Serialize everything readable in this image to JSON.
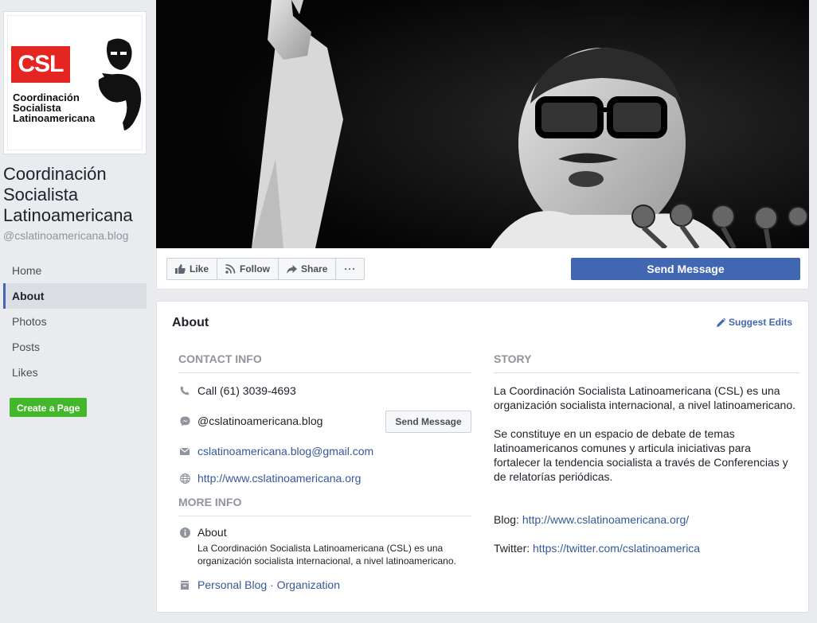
{
  "profile": {
    "logo_abbr": "CSL",
    "logo_line1": "Coordinación",
    "logo_line2": "Socialista",
    "logo_line3": "Latinoamericana",
    "page_name": "Coordinación Socialista Latinoamericana",
    "handle": "@cslatinoamericana.blog"
  },
  "nav": {
    "items": [
      {
        "label": "Home"
      },
      {
        "label": "About"
      },
      {
        "label": "Photos"
      },
      {
        "label": "Posts"
      },
      {
        "label": "Likes"
      }
    ],
    "active": "About"
  },
  "create_page": "Create a Page",
  "actions": {
    "like": "Like",
    "follow": "Follow",
    "share": "Share",
    "more": "···",
    "send_message": "Send Message"
  },
  "about": {
    "title": "About",
    "suggest_edits": "Suggest Edits",
    "contact_heading": "CONTACT INFO",
    "phone": "Call (61) 3039-4693",
    "messenger": "@cslatinoamericana.blog",
    "send_message": "Send Message",
    "email": "cslatinoamericana.blog@gmail.com",
    "website": "http://www.cslatinoamericana.org",
    "more_heading": "MORE INFO",
    "about_label": "About",
    "about_desc": "La Coordinación Socialista Latinoamericana (CSL) es una organización socialista internacional, a nivel latinoamericano.",
    "category_1": "Personal Blog",
    "category_sep": " · ",
    "category_2": "Organization",
    "story_heading": "STORY",
    "story_p1": "La Coordinación Socialista Latinoamericana (CSL) es una organización socialista internacional, a nivel latinoamericano.",
    "story_p2": "Se constituye en un espacio de debate de temas latinoamericanos comunes y articula iniciativas para fortalecer la tendencia socialista a través de Conferencias y de relatorías periódicas.",
    "blog_label": "Blog: ",
    "blog_url": "http://www.cslatinoamericana.org/",
    "twitter_label": "Twitter: ",
    "twitter_url": "https://twitter.com/cslatinoamerica"
  },
  "colors": {
    "brand_blue": "#4267b2",
    "link": "#365899",
    "green": "#42b72a",
    "logo_red": "#e52521"
  }
}
